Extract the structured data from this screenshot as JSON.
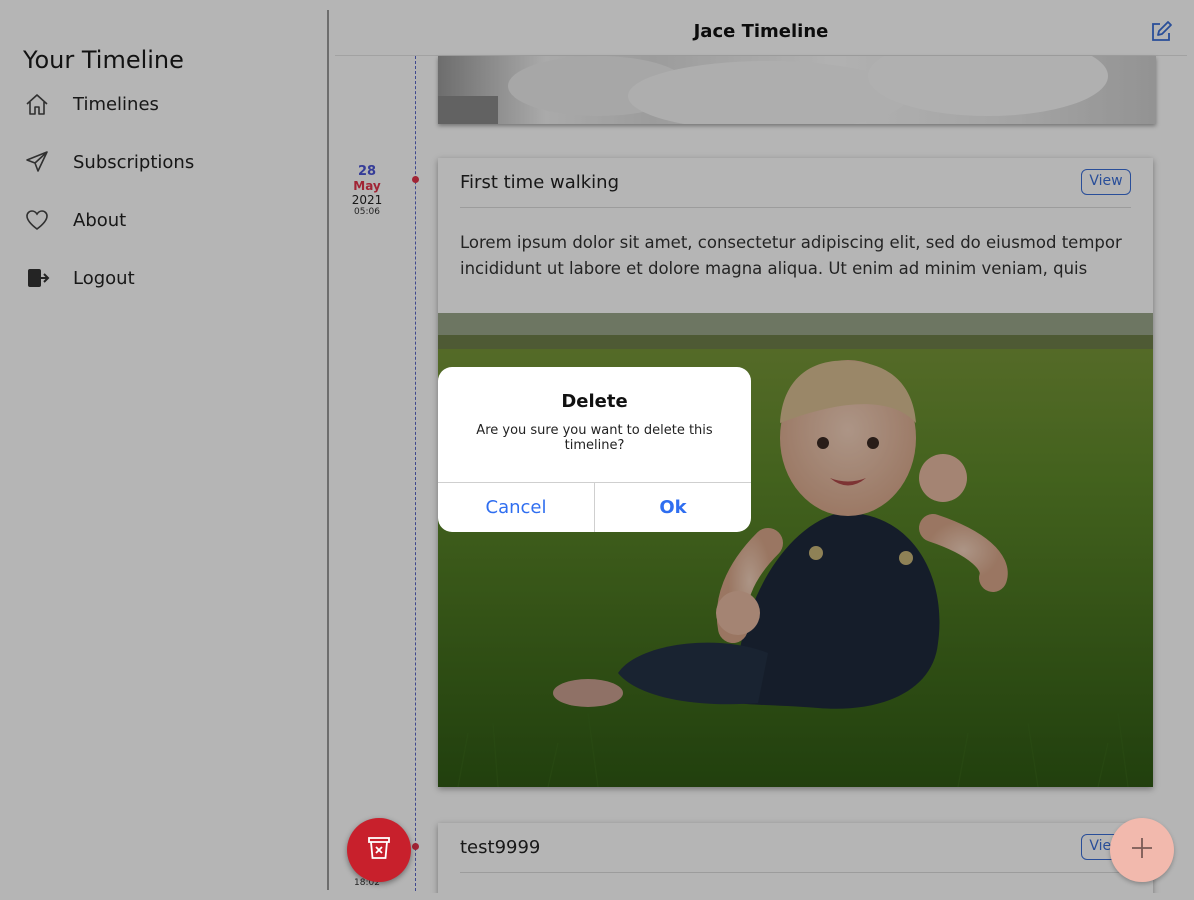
{
  "sidebar": {
    "title": "Your Timeline",
    "items": [
      {
        "label": "Timelines",
        "icon": "home-icon"
      },
      {
        "label": "Subscriptions",
        "icon": "paper-plane-icon"
      },
      {
        "label": "About",
        "icon": "heart-icon"
      },
      {
        "label": "Logout",
        "icon": "logout-icon"
      }
    ]
  },
  "header": {
    "title": "Jace Timeline",
    "edit_icon": "edit-icon"
  },
  "entries": [
    {
      "date": {
        "day": "28",
        "month": "May",
        "year": "2021",
        "time": "05:06"
      },
      "title": "First time walking",
      "view_label": "View",
      "description": "Lorem ipsum dolor sit amet, consectetur adipiscing elit, sed do eiusmod tempor incididunt ut labore et dolore magna aliqua. Ut enim ad minim veniam, quis"
    },
    {
      "date": {
        "time": "18:02"
      },
      "title": "test9999",
      "view_label": "View"
    }
  ],
  "dialog": {
    "title": "Delete",
    "message": "Are you sure you want to delete this timeline?",
    "cancel_label": "Cancel",
    "ok_label": "Ok"
  },
  "fabs": {
    "delete_icon": "trash-icon",
    "add_icon": "plus-icon"
  },
  "colors": {
    "accent_blue": "#3b6fd8",
    "date_day": "#4b55d6",
    "date_month": "#e3334a",
    "delete_fab": "#c8202c",
    "add_fab": "#f2b9ad",
    "dialog_button": "#2f6ef0"
  }
}
